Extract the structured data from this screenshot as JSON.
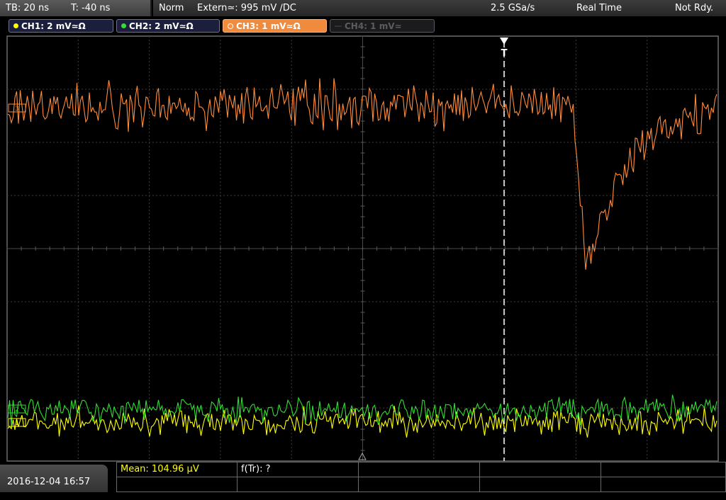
{
  "status": {
    "timebase": "TB: 20 ns",
    "trigger_time": "T: -40 ns",
    "mode": "Norm",
    "trigger_source": "Extern≃: 995 mV ∕DC",
    "sample_rate": "2.5 GSa/s",
    "acq_mode": "Real Time",
    "state": "Not Rdy."
  },
  "channels": [
    {
      "label": "CH1: 2 mV≃Ω",
      "color": "#ffff00",
      "active": true
    },
    {
      "label": "CH2: 2 mV≃Ω",
      "color": "#33dd33",
      "active": true
    },
    {
      "label": "CH3: 1 mV≃Ω",
      "color": "#ff8c3a",
      "active": true,
      "selected": true
    },
    {
      "label": "CH4: 1 mV≃",
      "color": "#5b5b60",
      "active": false
    }
  ],
  "markers": {
    "ch3": "3",
    "ch2": "2",
    "ch1": "1",
    "trigger": "T"
  },
  "measurements": {
    "mean": "Mean: 104.96 µV",
    "f_tr": "f(Tr): ?"
  },
  "datetime": "2016-12-04 16:57",
  "colors": {
    "ch1": "#ffff00",
    "ch2": "#33dd33",
    "ch3": "#ff8c3a",
    "grid": "#5a5a5a",
    "background": "#000000"
  }
}
